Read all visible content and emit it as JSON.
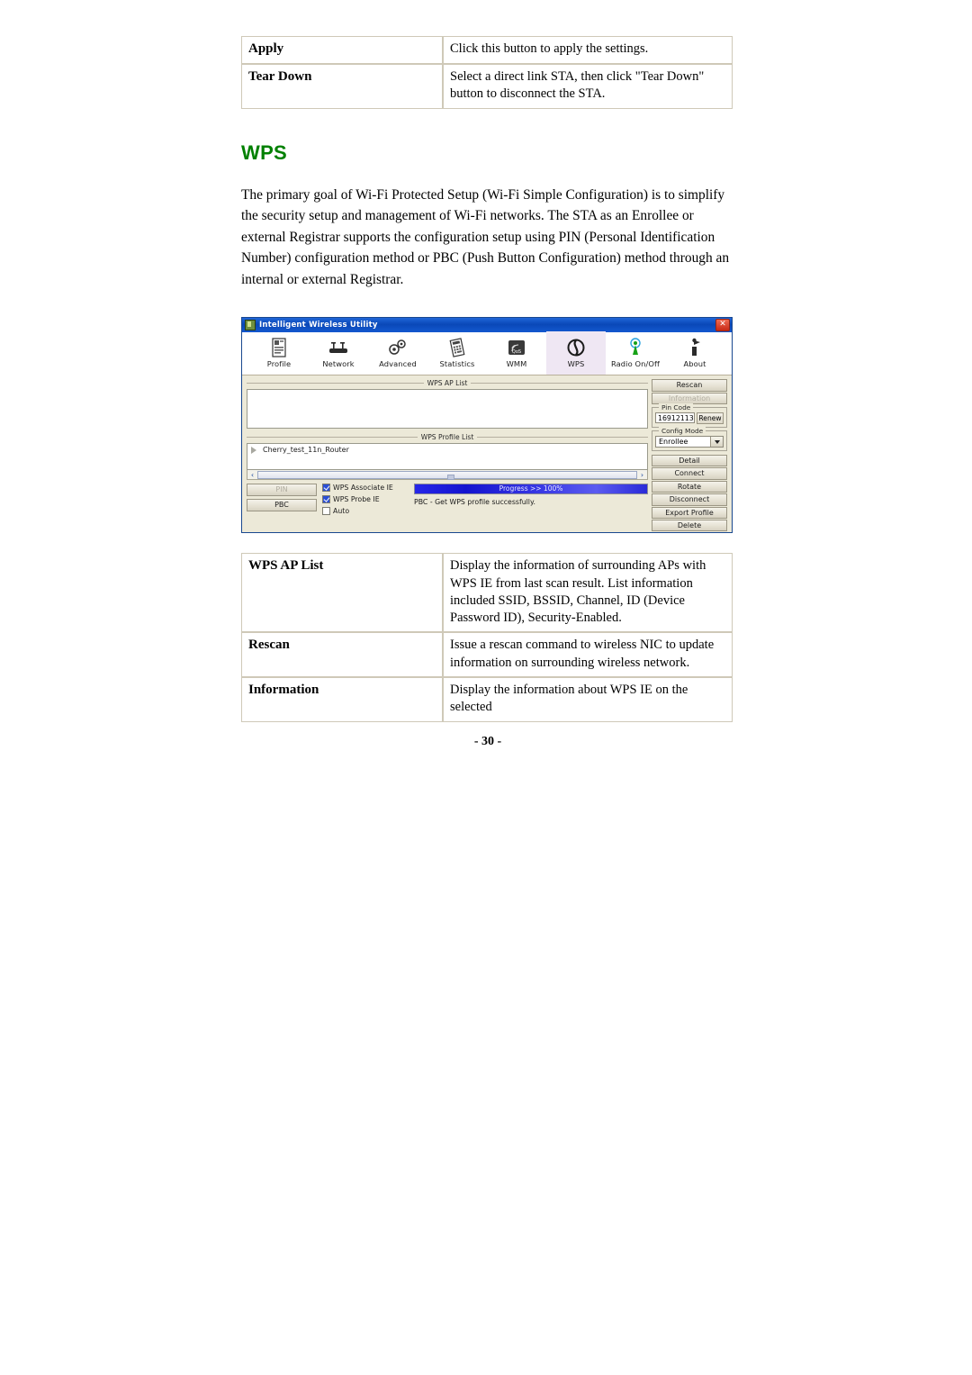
{
  "top_table": {
    "rows": [
      {
        "key": "Apply",
        "value": "Click this button to apply the settings."
      },
      {
        "key": "Tear Down",
        "value": "Select a direct link STA, then click \"Tear Down\" button to disconnect the STA."
      }
    ]
  },
  "section": {
    "heading": "WPS",
    "paragraph": "The primary goal of Wi-Fi Protected Setup (Wi-Fi Simple Configuration) is to simplify the security setup and management of Wi-Fi networks. The STA as an Enrollee or external Registrar supports the configuration setup using PIN (Personal Identification Number) configuration method or PBC (Push Button Configuration) method through an internal or external Registrar."
  },
  "app": {
    "title": "Intelligent Wireless Utility",
    "close_label": "✕",
    "toolbar": [
      {
        "label": "Profile",
        "icon": "profile-icon",
        "active": false
      },
      {
        "label": "Network",
        "icon": "network-icon",
        "active": false
      },
      {
        "label": "Advanced",
        "icon": "advanced-gears-icon",
        "active": false
      },
      {
        "label": "Statistics",
        "icon": "statistics-icon",
        "active": false
      },
      {
        "label": "WMM",
        "icon": "wmm-qos-icon",
        "active": false
      },
      {
        "label": "WPS",
        "icon": "wps-icon",
        "active": true
      },
      {
        "label": "Radio On/Off",
        "icon": "radio-antenna-icon",
        "active": false
      },
      {
        "label": "About",
        "icon": "about-icon",
        "active": false
      }
    ],
    "ap_list_label": "WPS AP List",
    "profile_list_label": "WPS Profile List",
    "profile_entry": "Cherry_test_11n_Router",
    "scroll_left": "‹",
    "scroll_right": "›",
    "mode_buttons": [
      {
        "label": "PIN",
        "disabled": true
      },
      {
        "label": "PBC",
        "disabled": false
      }
    ],
    "checkboxes": [
      {
        "label": "WPS Associate IE",
        "checked": true
      },
      {
        "label": "WPS Probe IE",
        "checked": true
      },
      {
        "label": "Auto",
        "checked": false
      }
    ],
    "progress_text": "Progress >> 100%",
    "status_text": "PBC - Get WPS profile successfully.",
    "side_buttons_top": [
      {
        "label": "Rescan",
        "disabled": false
      },
      {
        "label": "Information",
        "disabled": true
      }
    ],
    "pin_code": {
      "legend": "Pin Code",
      "value": "16912113",
      "renew_label": "Renew"
    },
    "config_mode": {
      "legend": "Config Mode",
      "value": "Enrollee"
    },
    "side_buttons_bottom": [
      {
        "label": "Detail",
        "disabled": false
      },
      {
        "label": "Connect",
        "disabled": false
      },
      {
        "label": "Rotate",
        "disabled": false
      },
      {
        "label": "Disconnect",
        "disabled": false
      },
      {
        "label": "Export Profile",
        "disabled": false
      },
      {
        "label": "Delete",
        "disabled": false
      }
    ]
  },
  "bottom_table": {
    "rows": [
      {
        "key": "WPS AP List",
        "value": "Display the information of surrounding APs with WPS IE from last scan result. List information included SSID, BSSID, Channel, ID (Device Password ID), Security-Enabled."
      },
      {
        "key": "Rescan",
        "value": "Issue a rescan command to wireless NIC to update information on surrounding wireless network."
      },
      {
        "key": "Information",
        "value": "Display the information about WPS IE on the selected"
      }
    ]
  },
  "footer": {
    "page_number": "- 30 -"
  },
  "colors": {
    "heading_green": "#008000",
    "titlebar_blue": "#0a48b8",
    "progress_blue": "#2626e8",
    "table_border": "#cfc9b8"
  }
}
